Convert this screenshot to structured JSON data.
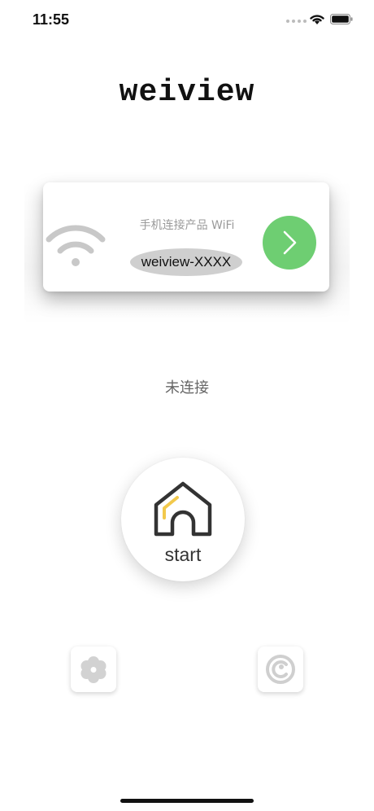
{
  "status_bar": {
    "time": "11:55"
  },
  "brand": {
    "title": "weiview"
  },
  "wifi_card": {
    "prompt": "手机连接产品 WiFi",
    "ssid": "weiview-XXXX",
    "icon": "wifi-icon",
    "action_icon": "chevron-right-icon",
    "action_color": "#6ece72"
  },
  "connection": {
    "status": "未连接"
  },
  "start": {
    "label": "start",
    "icon": "home-icon",
    "accent_color": "#f2c94c"
  },
  "bottom_actions": {
    "settings_icon": "flower-gear-icon",
    "about_icon": "copyright-icon"
  }
}
